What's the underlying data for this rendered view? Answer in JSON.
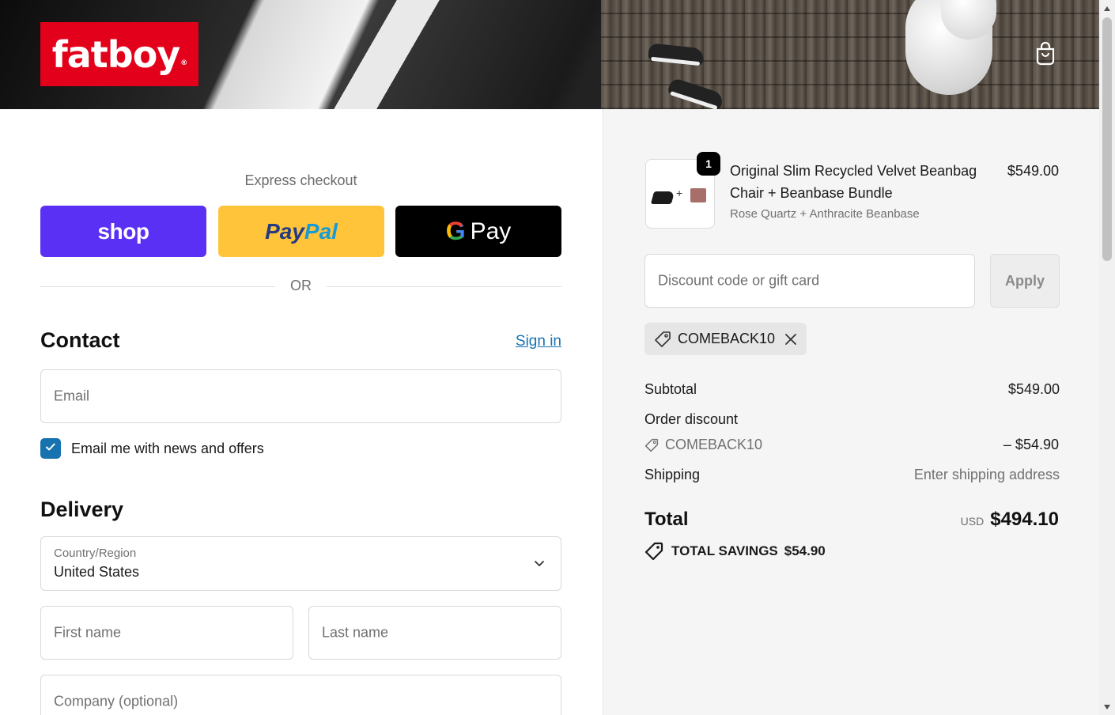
{
  "brand": {
    "logo_text": "fatboy",
    "logo_mark": "®",
    "color": "#e2001a"
  },
  "express": {
    "label": "Express checkout",
    "shop_label": "shop",
    "paypal_part1": "Pay",
    "paypal_part2": "Pal",
    "gpay_g": "G",
    "gpay_label": "Pay",
    "or_label": "OR"
  },
  "contact": {
    "title": "Contact",
    "sign_in": "Sign in",
    "email_placeholder": "Email",
    "newsletter_label": "Email me with news and offers",
    "newsletter_checked": true
  },
  "delivery": {
    "title": "Delivery",
    "country_label": "Country/Region",
    "country_value": "United States",
    "first_name_placeholder": "First name",
    "last_name_placeholder": "Last name",
    "company_placeholder": "Company (optional)"
  },
  "summary": {
    "product": {
      "quantity": "1",
      "title": "Original Slim Recycled Velvet Beanbag Chair + Beanbase Bundle",
      "variant": "Rose Quartz + Anthracite Beanbase",
      "price": "$549.00",
      "thumb_plus": "+"
    },
    "discount_placeholder": "Discount code or gift card",
    "apply_label": "Apply",
    "applied_code": "COMEBACK10",
    "subtotal_label": "Subtotal",
    "subtotal_value": "$549.00",
    "order_discount_label": "Order discount",
    "order_discount_code": "COMEBACK10",
    "order_discount_value": "– $54.90",
    "shipping_label": "Shipping",
    "shipping_value": "Enter shipping address",
    "total_label": "Total",
    "currency": "USD",
    "total_value": "$494.10",
    "savings_label": "TOTAL SAVINGS",
    "savings_value": "$54.90"
  },
  "colors": {
    "accent": "#1773b0",
    "shop": "#5a31f4",
    "paypal": "#ffc439",
    "gpay": "#000000"
  }
}
